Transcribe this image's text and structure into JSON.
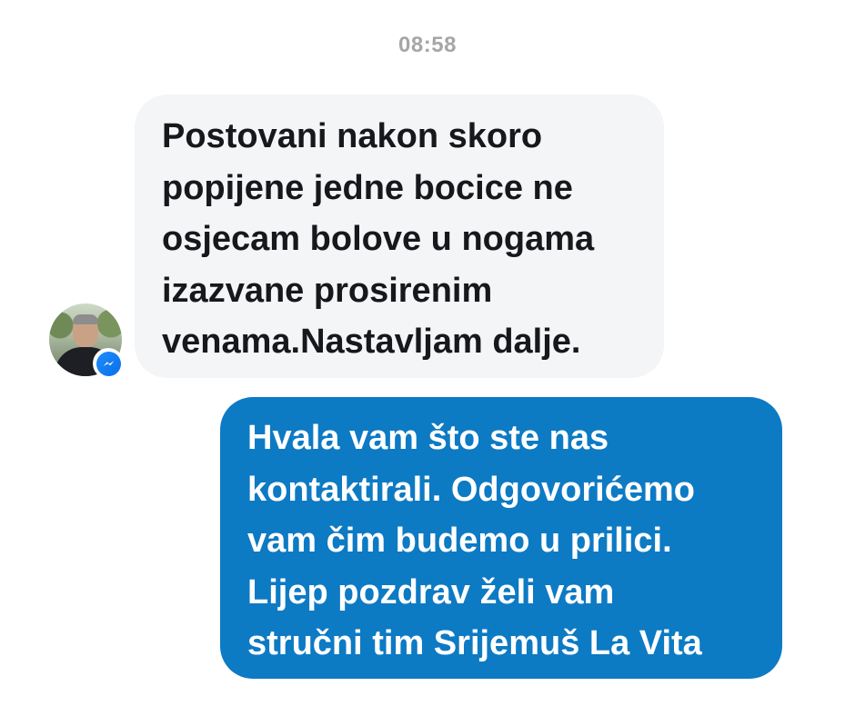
{
  "conversation": {
    "timestamp": "08:58",
    "messages": [
      {
        "direction": "incoming",
        "text": "Postovani nakon skoro\npopijene jedne bocice ne\nosjecam bolove u nogama\nizazvane prosirenim\nvenama.Nastavljam dalje."
      },
      {
        "direction": "outgoing",
        "text": "Hvala vam što ste nas\nkontaktirali. Odgovorićemo\nvam čim budemo u prilici.\nLijep pozdrav želi vam\nstručni tim Srijemuš La Vita"
      }
    ]
  },
  "sender": {
    "avatar_icon": "user-photo-avatar",
    "badge_icon": "messenger-icon"
  },
  "colors": {
    "incoming_bubble": "#f4f5f7",
    "incoming_text": "#16181b",
    "outgoing_bubble": "#0d7ac4",
    "outgoing_text": "#ffffff",
    "timestamp": "#a6a6a6",
    "messenger_blue": "#0a7cff"
  }
}
